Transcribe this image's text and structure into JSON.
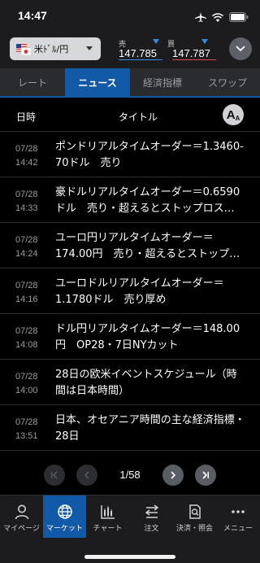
{
  "status_bar": {
    "time": "14:47"
  },
  "header": {
    "currency_pair": "米ﾄﾞﾙ/円",
    "bid_label": "売",
    "bid_price": "147.785",
    "ask_label": "買",
    "ask_price": "147.787",
    "colors": {
      "bid": "#2e8de8",
      "ask": "#e04848"
    }
  },
  "tabs": [
    {
      "label": "レート",
      "active": false
    },
    {
      "label": "ニュース",
      "active": true
    },
    {
      "label": "経済指標",
      "active": false
    },
    {
      "label": "スワップ",
      "active": false
    }
  ],
  "table_header": {
    "date": "日時",
    "title": "タイトル",
    "font_size_icon": "A"
  },
  "news": [
    {
      "date": "07/28",
      "time": "14:42",
      "title": "ポンドリアルタイムオーダー＝1.3460-70ドル　売り"
    },
    {
      "date": "07/28",
      "time": "14:33",
      "title": "豪ドルリアルタイムオーダー＝0.6590ドル　売り・超えるとストップロス…"
    },
    {
      "date": "07/28",
      "time": "14:24",
      "title": "ユーロ円リアルタイムオーダー＝174.00円　売り・超えるとストップ…"
    },
    {
      "date": "07/28",
      "time": "14:16",
      "title": "ユーロドルリアルタイムオーダー＝1.1780ドル　売り厚め"
    },
    {
      "date": "07/28",
      "time": "14:08",
      "title": "ドル円リアルタイムオーダー＝148.00円　OP28・7日NYカット"
    },
    {
      "date": "07/28",
      "time": "14:00",
      "title": "28日の欧米イベントスケジュール（時間は日本時間）"
    },
    {
      "date": "07/28",
      "time": "13:51",
      "title": "日本、オセアニア時間の主な経済指標・28日"
    }
  ],
  "pager": {
    "current": "1/58"
  },
  "bottom_nav": [
    {
      "label": "マイページ",
      "icon": "person-icon",
      "active": false
    },
    {
      "label": "マーケット",
      "icon": "globe-icon",
      "active": true
    },
    {
      "label": "チャート",
      "icon": "chart-icon",
      "active": false
    },
    {
      "label": "注文",
      "icon": "order-icon",
      "active": false
    },
    {
      "label": "決済・照会",
      "icon": "document-search-icon",
      "active": false
    },
    {
      "label": "メニュー",
      "icon": "more-icon",
      "active": false
    }
  ],
  "theme": {
    "accent": "#1259a8",
    "background": "#000000",
    "surface": "#1c1c1e"
  }
}
